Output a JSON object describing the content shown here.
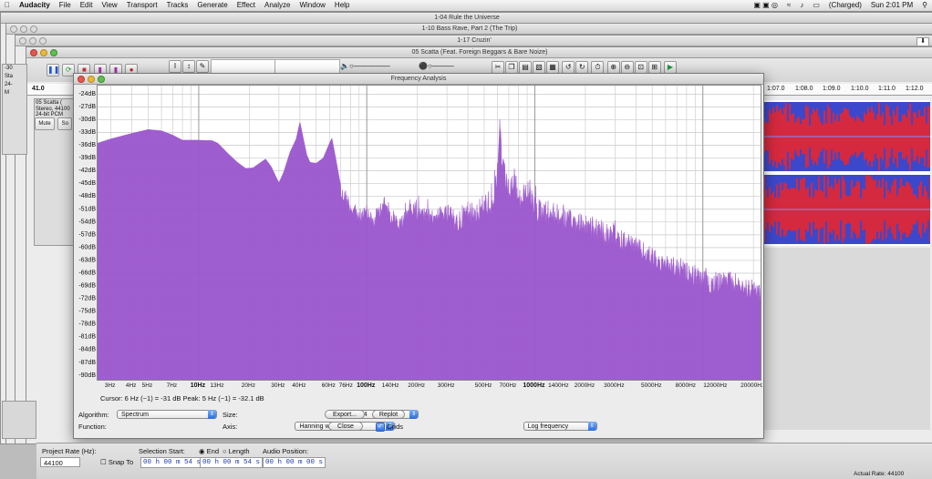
{
  "menubar": {
    "app_name": "Audacity",
    "items": [
      "File",
      "Edit",
      "View",
      "Transport",
      "Tracks",
      "Generate",
      "Effect",
      "Analyze",
      "Window",
      "Help"
    ],
    "status_right": "(Charged)",
    "clock": "Sun 2:01 PM"
  },
  "windows": {
    "w1_title": "1-04 Rule the Universe",
    "w2_title": "1-10 Bass Rave, Part 2 (The Trip)",
    "w3_title": "1-17 Cruzin'",
    "w4_title": "05 Scatta (Feat. Foreign Beggars & Bare Noize)"
  },
  "timeline": {
    "left_value": "41.0",
    "ticks": [
      "1:07.0",
      "1:08.0",
      "1:09.0",
      "1:10.0",
      "1:11.0",
      "1:12.0"
    ]
  },
  "track": {
    "name": "05 Scatta (",
    "info_line1": "Stereo, 44100",
    "info_line2": "24-bit PCM",
    "mute": "Mute",
    "solo": "So",
    "side_labels": [
      "-30",
      "Sta",
      "24-",
      "M"
    ]
  },
  "dialog": {
    "title": "Frequency Analysis",
    "cursor_text": "Cursor: 6 Hz (~1) = -31 dB   Peak: 5 Hz (~1) = -32.1 dB",
    "algorithm_label": "Algorithm:",
    "algorithm_value": "Spectrum",
    "size_label": "Size:",
    "size_value": "16384",
    "function_label": "Function:",
    "function_value": "Hanning window",
    "axis_label": "Axis:",
    "axis_value": "Log frequency",
    "export_button": "Export...",
    "replot_button": "Replot",
    "close_button": "Close",
    "grids_label": "Grids",
    "grids_checked": true
  },
  "selection_bar": {
    "project_rate_label": "Project Rate (Hz):",
    "project_rate_value": "44100",
    "selection_start_label": "Selection Start:",
    "end_label": "End",
    "length_label": "Length",
    "audio_position_label": "Audio Position:",
    "snap_to_label": "Snap To",
    "start_time": "00 h 00 m 54 s",
    "end_time": "00 h 00 m 54 s",
    "audio_position": "00 h 00 m 00 s",
    "actual_rate": "Actual Rate: 44100"
  },
  "colors": {
    "spectrum_fill": "#9a55cc",
    "wave_blue": "#3c48cc",
    "wave_red": "#ee2424"
  },
  "chart_data": {
    "type": "area",
    "title": "",
    "xlabel": "",
    "ylabel": "",
    "x_scale": "log",
    "xlim_hz": [
      2.5,
      22050
    ],
    "ylim_db": [
      -91,
      -22
    ],
    "grid": true,
    "x_tick_labels": [
      {
        "hz": 3,
        "label": "3Hz"
      },
      {
        "hz": 4,
        "label": "4Hz"
      },
      {
        "hz": 5,
        "label": "5Hz"
      },
      {
        "hz": 7,
        "label": "7Hz"
      },
      {
        "hz": 10,
        "label": "10Hz"
      },
      {
        "hz": 13,
        "label": "13Hz"
      },
      {
        "hz": 20,
        "label": "20Hz"
      },
      {
        "hz": 30,
        "label": "30Hz"
      },
      {
        "hz": 40,
        "label": "40Hz"
      },
      {
        "hz": 60,
        "label": "60Hz"
      },
      {
        "hz": 76,
        "label": "76Hz"
      },
      {
        "hz": 100,
        "label": "100Hz"
      },
      {
        "hz": 140,
        "label": "140Hz"
      },
      {
        "hz": 200,
        "label": "200Hz"
      },
      {
        "hz": 300,
        "label": "300Hz"
      },
      {
        "hz": 500,
        "label": "500Hz"
      },
      {
        "hz": 700,
        "label": "700Hz"
      },
      {
        "hz": 1000,
        "label": "1000Hz"
      },
      {
        "hz": 1400,
        "label": "1400Hz"
      },
      {
        "hz": 2000,
        "label": "2000Hz"
      },
      {
        "hz": 3000,
        "label": "3000Hz"
      },
      {
        "hz": 5000,
        "label": "5000Hz"
      },
      {
        "hz": 8000,
        "label": "8000Hz"
      },
      {
        "hz": 12000,
        "label": "12000Hz"
      },
      {
        "hz": 20000,
        "label": "20000Hz"
      }
    ],
    "y_tick_labels": [
      "-24dB",
      "-27dB",
      "-30dB",
      "-33dB",
      "-36dB",
      "-39dB",
      "-42dB",
      "-45dB",
      "-48dB",
      "-51dB",
      "-54dB",
      "-57dB",
      "-60dB",
      "-63dB",
      "-66dB",
      "-69dB",
      "-72dB",
      "-75dB",
      "-78dB",
      "-81dB",
      "-84dB",
      "-87dB",
      "-90dB"
    ],
    "y_tick_values": [
      -24,
      -27,
      -30,
      -33,
      -36,
      -39,
      -42,
      -45,
      -48,
      -51,
      -54,
      -57,
      -60,
      -63,
      -66,
      -69,
      -72,
      -75,
      -78,
      -81,
      -84,
      -87,
      -90
    ],
    "series": [
      {
        "envelope": [
          [
            2.5,
            -35.5
          ],
          [
            3,
            -34.5
          ],
          [
            4,
            -33.2
          ],
          [
            5,
            -32.3
          ],
          [
            6,
            -32.6
          ],
          [
            7,
            -33.6
          ],
          [
            8,
            -34.8
          ],
          [
            9,
            -34.8
          ],
          [
            10,
            -34.8
          ],
          [
            12,
            -34.9
          ],
          [
            13,
            -35.5
          ],
          [
            15,
            -38
          ],
          [
            17,
            -40
          ],
          [
            19,
            -41.4
          ],
          [
            21,
            -41.3
          ],
          [
            23,
            -40.2
          ],
          [
            25,
            -39.2
          ],
          [
            27,
            -41
          ],
          [
            30,
            -44.8
          ],
          [
            32,
            -42.3
          ],
          [
            35,
            -37.5
          ],
          [
            38,
            -34.5
          ],
          [
            40,
            -30.5
          ],
          [
            42,
            -34.5
          ],
          [
            44,
            -38.3
          ],
          [
            46,
            -40
          ],
          [
            50,
            -40.2
          ],
          [
            55,
            -39
          ],
          [
            60,
            -35.5
          ],
          [
            62,
            -34.3
          ],
          [
            65,
            -38.5
          ],
          [
            70,
            -45.5
          ],
          [
            75,
            -46.2
          ],
          [
            80,
            -48.5
          ],
          [
            90,
            -51
          ],
          [
            100,
            -50
          ],
          [
            110,
            -52
          ],
          [
            125,
            -47.5
          ],
          [
            140,
            -50.5
          ],
          [
            160,
            -53
          ],
          [
            180,
            -48.5
          ],
          [
            200,
            -50
          ],
          [
            230,
            -51
          ],
          [
            260,
            -50.5
          ],
          [
            300,
            -50
          ],
          [
            350,
            -51
          ],
          [
            400,
            -48.5
          ],
          [
            450,
            -49
          ],
          [
            500,
            -47
          ],
          [
            560,
            -46.5
          ],
          [
            600,
            -39
          ],
          [
            620,
            -27.5
          ],
          [
            640,
            -38
          ],
          [
            700,
            -44
          ],
          [
            760,
            -42
          ],
          [
            800,
            -46.5
          ],
          [
            900,
            -44
          ],
          [
            1000,
            -48
          ],
          [
            1200,
            -49
          ],
          [
            1400,
            -50
          ],
          [
            1600,
            -51
          ],
          [
            2000,
            -52
          ],
          [
            2500,
            -53.5
          ],
          [
            3000,
            -55.5
          ],
          [
            3500,
            -56
          ],
          [
            4000,
            -57.5
          ],
          [
            5000,
            -60
          ],
          [
            6000,
            -61.5
          ],
          [
            7000,
            -62.5
          ],
          [
            8000,
            -63.5
          ],
          [
            9000,
            -64
          ],
          [
            10000,
            -65.5
          ],
          [
            12000,
            -66
          ],
          [
            14000,
            -65.5
          ],
          [
            16000,
            -66
          ],
          [
            18000,
            -67
          ],
          [
            20000,
            -67.5
          ],
          [
            22050,
            -68
          ]
        ]
      }
    ]
  }
}
